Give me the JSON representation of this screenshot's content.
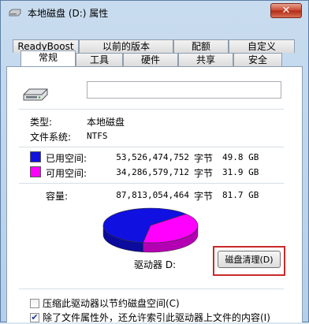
{
  "window": {
    "title": "本地磁盘 (D:) 属性",
    "close_label": "✕"
  },
  "tabs_row1": [
    {
      "label": "ReadyBoost"
    },
    {
      "label": "以前的版本"
    },
    {
      "label": "配额"
    },
    {
      "label": "自定义"
    }
  ],
  "tabs_row2": [
    {
      "label": "常规",
      "active": true
    },
    {
      "label": "工具"
    },
    {
      "label": "硬件"
    },
    {
      "label": "共享"
    },
    {
      "label": "安全"
    }
  ],
  "general": {
    "name_value": "",
    "type_label": "类型:",
    "type_value": "本地磁盘",
    "fs_label": "文件系统:",
    "fs_value": "NTFS",
    "used": {
      "label": "已用空间:",
      "bytes": "53,526,474,752",
      "unit": "字节",
      "size": "49.8 GB",
      "color": "#1010e0"
    },
    "free": {
      "label": "可用空间:",
      "bytes": "34,286,579,712",
      "unit": "字节",
      "size": "31.9 GB",
      "color": "#ff00ff"
    },
    "capacity": {
      "label": "容量:",
      "bytes": "87,813,054,464",
      "unit": "字节",
      "size": "81.7 GB"
    },
    "drive_label": "驱动器 D:",
    "cleanup_button": "磁盘清理(D)",
    "compress_label": "压缩此驱动器以节约磁盘空间(C)",
    "compress_checked": false,
    "index_label": "除了文件属性外，还允许索引此驱动器上文件的内容(I)",
    "index_checked": true
  },
  "chart_data": {
    "type": "pie",
    "series": [
      {
        "name": "已用空间",
        "value": 53526474752,
        "color": "#1010e0"
      },
      {
        "name": "可用空间",
        "value": 34286579712,
        "color": "#ff00ff"
      }
    ]
  }
}
